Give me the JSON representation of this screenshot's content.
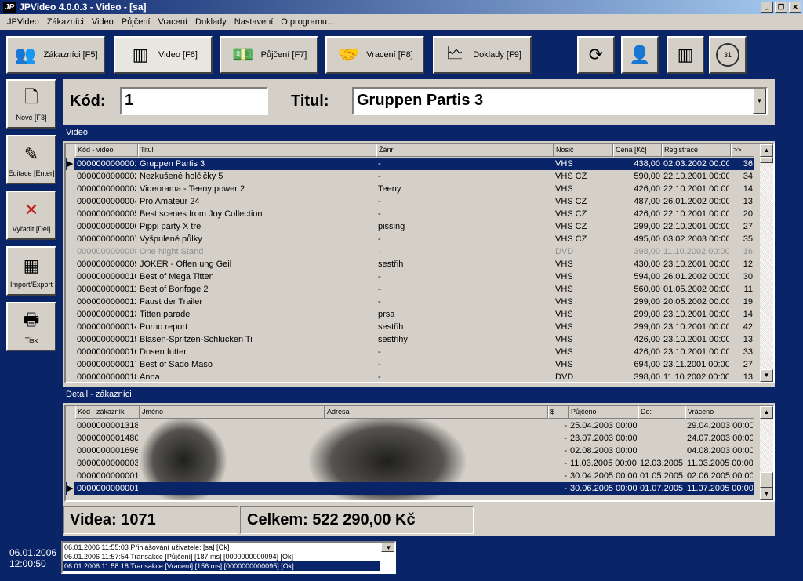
{
  "window": {
    "logo": "JP",
    "title": "JPVideo 4.0.0.3 - Video - [sa]"
  },
  "menu": [
    "JPVideo",
    "Zákazníci",
    "Video",
    "Půjčení",
    "Vracení",
    "Doklady",
    "Nastavení",
    "O programu..."
  ],
  "toolbar": [
    {
      "label": "Zákazníci [F5]",
      "icon": "customers-icon"
    },
    {
      "label": "Video [F6]",
      "icon": "barcode-icon"
    },
    {
      "label": "Půjčení [F7]",
      "icon": "money-icon"
    },
    {
      "label": "Vracení [F8]",
      "icon": "handshake-icon"
    },
    {
      "label": "Doklady [F9]",
      "icon": "document-icon"
    }
  ],
  "toolbar_icons": [
    "refresh-icon",
    "customer-icon",
    "barcode-icon",
    "calendar-icon"
  ],
  "calendar_day": "31",
  "side": [
    {
      "label": "Nové [F3]",
      "icon": "new-document-icon"
    },
    {
      "label": "Editace [Enter]",
      "icon": "edit-icon"
    },
    {
      "label": "Vyřadit [Del]",
      "icon": "delete-icon"
    },
    {
      "label": "Import/Export",
      "icon": "xls-icon"
    },
    {
      "label": "Tisk",
      "icon": "printer-icon"
    }
  ],
  "search": {
    "code_label": "Kód:",
    "code_value": "1",
    "title_label": "Titul:",
    "title_value": "Gruppen Partis 3"
  },
  "video": {
    "section": "Video",
    "headers": [
      "Kód - video",
      "Titul",
      "Žánr",
      "Nosič",
      "Cena [Kč]",
      "Registrace",
      ">>"
    ],
    "rows": [
      [
        "0000000000001",
        "Gruppen Partis 3",
        "-",
        "VHS",
        "438,00",
        "02.03.2002 00:00",
        "36"
      ],
      [
        "0000000000002",
        "Nezkušené holčičky 5",
        "-",
        "VHS CZ",
        "590,00",
        "22.10.2001 00:00",
        "34"
      ],
      [
        "0000000000003",
        "Videorama - Teeny power 2",
        "Teeny",
        "VHS",
        "426,00",
        "22.10.2001 00:00",
        "14"
      ],
      [
        "0000000000004",
        "Pro Amateur 24",
        "-",
        "VHS CZ",
        "487,00",
        "26.01.2002 00:00",
        "13"
      ],
      [
        "0000000000005",
        "Best scenes from Joy Collection",
        "-",
        "VHS CZ",
        "426,00",
        "22.10.2001 00:00",
        "20"
      ],
      [
        "0000000000006",
        "Pippi party X tre",
        "pissing",
        "VHS CZ",
        "299,00",
        "22.10.2001 00:00",
        "27"
      ],
      [
        "0000000000007",
        "Vyšpulené půlky",
        "-",
        "VHS CZ",
        "495,00",
        "03.02.2003 00:00",
        "35"
      ],
      [
        "0000000000008",
        "One Night Stand",
        "-",
        "DVD",
        "398,00",
        "11.10.2002 00:00",
        "16"
      ],
      [
        "0000000000009",
        "JOKER - Offen ung Geil",
        "sestřih",
        "VHS",
        "430,00",
        "23.10.2001 00:00",
        "12"
      ],
      [
        "0000000000010",
        "Best of Mega Titten",
        "-",
        "VHS",
        "594,00",
        "26.01.2002 00:00",
        "30"
      ],
      [
        "0000000000011",
        "Best of Bonfage 2",
        "-",
        "VHS",
        "560,00",
        "01.05.2002 00:00",
        "11"
      ],
      [
        "0000000000012",
        "Faust der Trailer",
        "-",
        "VHS",
        "299,00",
        "20.05.2002 00:00",
        "19"
      ],
      [
        "0000000000013",
        "Titten  parade",
        "prsa",
        "VHS",
        "299,00",
        "23.10.2001 00:00",
        "14"
      ],
      [
        "0000000000014",
        "Porno report",
        "sestřih",
        "VHS",
        "299,00",
        "23.10.2001 00:00",
        "42"
      ],
      [
        "0000000000015",
        "Blasen-Spritzen-Schlucken     Ti",
        "sestřihy",
        "VHS",
        "426,00",
        "23.10.2001 00:00",
        "13"
      ],
      [
        "0000000000016",
        "Dosen futter",
        "-",
        "VHS",
        "426,00",
        "23.10.2001 00:00",
        "33"
      ],
      [
        "0000000000017",
        "Best of Sado Maso",
        "-",
        "VHS",
        "694,00",
        "23.11.2001 00:00",
        "27"
      ],
      [
        "0000000000018",
        "Anna",
        "-",
        "DVD",
        "398,00",
        "11.10.2002 00:00",
        "13"
      ]
    ]
  },
  "detail": {
    "section": "Detail - zákazníci",
    "headers": [
      "Kód - zákazník",
      "Jméno",
      "Adresa",
      "$",
      "Půjčeno",
      "Do:",
      "Vráceno"
    ],
    "rows": [
      [
        "0000000001318",
        "",
        "",
        "-",
        "25.04.2003 00:00",
        "",
        "29.04.2003 00:00"
      ],
      [
        "0000000001480",
        "",
        "",
        "-",
        "23.07.2003 00:00",
        "",
        "24.07.2003 00:00"
      ],
      [
        "0000000001696",
        "",
        "",
        "-",
        "02.08.2003 00:00",
        "",
        "04.08.2003 00:00"
      ],
      [
        "0000000000003",
        "",
        "",
        "-",
        "11.03.2005 00:00",
        "12.03.2005",
        "11.03.2005 00:00"
      ],
      [
        "0000000000001",
        "",
        "",
        "-",
        "30.04.2005 00:00",
        "01.05.2005",
        "02.06.2005 00:00"
      ],
      [
        "0000000000001",
        "",
        "",
        "-",
        "30.06.2005 00:00",
        "01.07.2005",
        "11.07.2005 00:00"
      ]
    ]
  },
  "summary": {
    "count": "Videa: 1071",
    "total": "Celkem: 522 290,00 Kč"
  },
  "status": {
    "date": "06.01.2006",
    "time": "12:00:50",
    "log": [
      "06.01.2006 11:55:03 Přihlášování uživatele: [sa] [Ok]",
      "06.01.2006 11:57:54 Transakce [Půjčení] [187 ms] [0000000000094] [Ok]",
      "06.01.2006 11:58:18 Transakce [Vracení] [156 ms] [0000000000095] [Ok]"
    ]
  }
}
